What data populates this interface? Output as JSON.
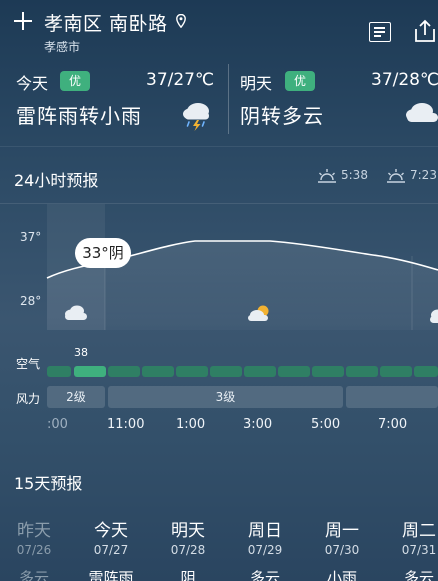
{
  "header": {
    "location": "孝南区 南卧路",
    "city": "孝感市"
  },
  "today": {
    "label": "今天",
    "aqi": "优",
    "temp_range": "37/27℃",
    "condition": "雷阵雨转小雨",
    "icon": "thunder-rain-icon"
  },
  "tomorrow": {
    "label": "明天",
    "aqi": "优",
    "temp_range": "37/28℃",
    "condition": "阴转多云",
    "icon": "cloud-icon"
  },
  "hourly": {
    "title": "24小时预报",
    "sunrise": "5:38",
    "sunset": "7:23",
    "y_max": "37°",
    "y_min": "28°",
    "tooltip": "33°阴",
    "air_label": "空气",
    "air_value": "38",
    "wind_label": "风力",
    "wind_segments": [
      "2级",
      "3级"
    ],
    "hours": [
      ":00",
      "11:00",
      "1:00",
      "3:00",
      "5:00",
      "7:00"
    ]
  },
  "forecast": {
    "title": "15天预报",
    "days": [
      {
        "day": "昨天",
        "date": "07/26",
        "cond": "多云"
      },
      {
        "day": "今天",
        "date": "07/27",
        "cond": "雷阵雨"
      },
      {
        "day": "明天",
        "date": "07/28",
        "cond": "阴"
      },
      {
        "day": "周日",
        "date": "07/29",
        "cond": "多云"
      },
      {
        "day": "周一",
        "date": "07/30",
        "cond": "小雨"
      },
      {
        "day": "周二",
        "date": "07/31",
        "cond": "多云"
      }
    ]
  },
  "colors": {
    "aqi_good": "#3fb07e",
    "aqi_bar": "#2f7f64"
  }
}
